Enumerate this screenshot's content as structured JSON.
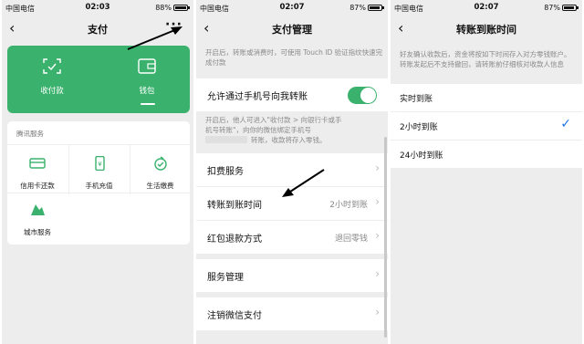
{
  "status_bars": [
    {
      "carrier": "中国电信",
      "time": "02:03",
      "battery": "88%"
    },
    {
      "carrier": "中国电信",
      "time": "02:07",
      "battery": "87%"
    },
    {
      "carrier": "中国电信",
      "time": "02:07",
      "battery": "87%"
    }
  ],
  "payment": {
    "title": "支付",
    "receive_pay": "收付款",
    "wallet": "钱包",
    "services_header": "腾讯服务",
    "services": [
      {
        "label": "信用卡还款",
        "icon": "credit-card-icon"
      },
      {
        "label": "手机充值",
        "icon": "mobile-topup-icon"
      },
      {
        "label": "生活缴费",
        "icon": "utility-bill-icon"
      },
      {
        "label": "城市服务",
        "icon": "city-service-icon"
      }
    ]
  },
  "management": {
    "title": "支付管理",
    "note_touchid": "开启后，转账或消费时，可使用 Touch ID 验证指纹快速完成付款",
    "allow_phone_transfer": "允许通过手机号向我转账",
    "note_phone_1": "开启后，他人可进入\"收付款 > 向银行卡或手",
    "note_phone_2": "机号转账\"，向你的微信绑定手机号",
    "note_phone_3": "转账，收款将存入零钱。",
    "deduct_service": "扣费服务",
    "transfer_time": "转账到账时间",
    "transfer_time_value": "2小时到账",
    "red_packet_refund": "红包退款方式",
    "red_packet_refund_value": "退回零钱",
    "service_management": "服务管理",
    "cancel_wechat_pay": "注销微信支付"
  },
  "transfer_time": {
    "title": "转账到账时间",
    "note": "好友确认收款后，资金将按如下时间存入对方零钱账户。转账发起后不支持撤回，请转账前仔细核对收款人信息",
    "options": [
      {
        "label": "实时到账",
        "selected": false
      },
      {
        "label": "2小时到账",
        "selected": true
      },
      {
        "label": "24小时到账",
        "selected": false
      }
    ],
    "check": "✓"
  },
  "colors": {
    "accent_green": "#3ab26d",
    "check_blue": "#1a73e8",
    "background": "#ededed"
  }
}
